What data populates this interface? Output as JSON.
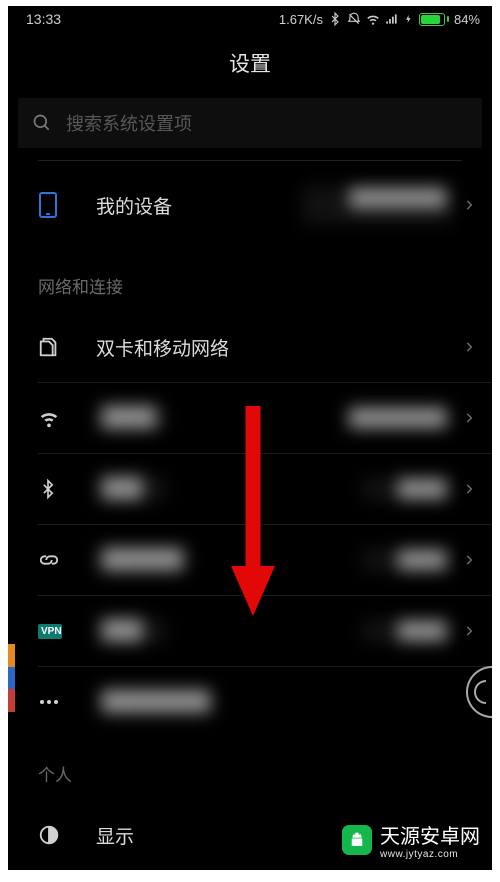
{
  "status": {
    "time": "13:33",
    "net_speed": "1.67K/s",
    "battery_pct": "84%"
  },
  "header": {
    "title": "设置"
  },
  "search": {
    "placeholder": "搜索系统设置项"
  },
  "rows": {
    "my_device": {
      "label": "我的设备"
    },
    "dual_sim": {
      "label": "双卡和移动网络"
    },
    "display": {
      "label": "显示"
    }
  },
  "sections": {
    "network": "网络和连接",
    "personal": "个人"
  },
  "vpn_badge": "VPN",
  "watermark": {
    "text": "天源安卓网",
    "subtext": "www.jytyaz.com"
  }
}
